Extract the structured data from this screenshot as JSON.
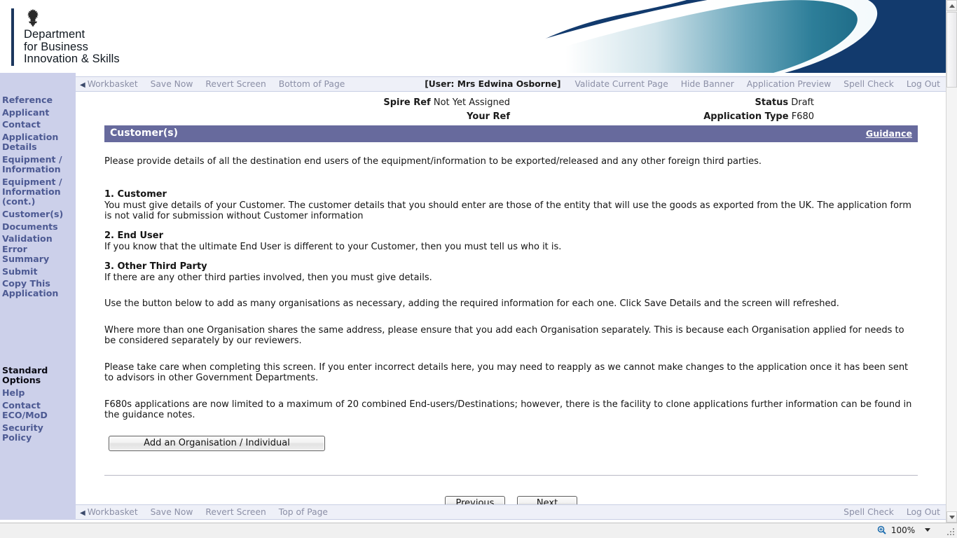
{
  "banner": {
    "crest_alt": "royal-crest",
    "department_line1": "Department",
    "department_line2": "for Business",
    "department_line3": "Innovation & Skills",
    "navy_color": "#123a6d",
    "swoosh_teal": "#2b7f99"
  },
  "topnav": {
    "workbasket": "Workbasket",
    "save_now": "Save Now",
    "revert_screen": "Revert Screen",
    "bottom_of_page": "Bottom of Page",
    "user": "[User: Mrs Edwina Osborne]",
    "validate_current_page": "Validate Current Page",
    "hide_banner": "Hide Banner",
    "application_preview": "Application Preview",
    "spell_check": "Spell Check",
    "log_out": "Log Out"
  },
  "sidebar": {
    "items": [
      {
        "label": "Reference"
      },
      {
        "label": "Applicant"
      },
      {
        "label": "Contact"
      },
      {
        "label": "Application\nDetails"
      },
      {
        "label": "Equipment /\nInformation"
      },
      {
        "label": "Equipment /\nInformation\n(cont.)"
      },
      {
        "label": "Customer(s)"
      },
      {
        "label": "Documents"
      },
      {
        "label": "Validation Error\nSummary"
      },
      {
        "label": "Submit"
      },
      {
        "label": "Copy This\nApplication"
      }
    ],
    "standard_options_heading": "Standard\nOptions",
    "standard_options": [
      {
        "label": "Help"
      },
      {
        "label": "Contact\nECO/MoD"
      },
      {
        "label": "Security Policy"
      }
    ],
    "bg_color": "#ccd0ea",
    "link_color": "#4d5a93"
  },
  "refbar": {
    "spire_ref_label": "Spire Ref",
    "spire_ref_value": "Not Yet Assigned",
    "your_ref_label": "Your Ref",
    "your_ref_value": "",
    "status_label": "Status",
    "status_value": "Draft",
    "application_type_label": "Application Type",
    "application_type_value": "F680"
  },
  "section": {
    "title": "Customer(s)",
    "guidance": "Guidance",
    "header_color": "#676a9d"
  },
  "body": {
    "intro": "Please provide details of all the destination end users of the equipment/information to be exported/released and any other foreign third parties.",
    "item1_heading": "1. Customer",
    "item1_text": "You must give details of your Customer. The customer details that you should enter are those of the entity that will use the goods as exported from the UK. The application form is not valid for submission without Customer information",
    "item2_heading": "2. End User",
    "item2_text": "If you know that the ultimate End User is different to your Customer, then you must tell us who it is.",
    "item3_heading": "3. Other Third Party",
    "item3_text": "If there are any other third parties involved, then you must give details.",
    "para_button": "Use the button below to add as many organisations as necessary, adding the required information for each one. Click Save Details and the screen will refreshed.",
    "para_address": "Where more than one Organisation shares the same address, please ensure that you add each Organisation separately. This is because each Organisation applied for needs to be considered separately by our reviewers.",
    "para_care": "Please take care when completing this screen. If you enter incorrect details here, you may need to reapply as we cannot make changes to the application once it has been sent to advisors in other Government Departments.",
    "para_limit": "F680s applications are now limited to a maximum of 20 combined End-users/Destinations; however, there is the facility to clone applications further information can be found in the guidance notes."
  },
  "buttons": {
    "add_organisation": "Add an Organisation / Individual",
    "previous": "Previous",
    "next": "Next"
  },
  "footnav": {
    "workbasket": "Workbasket",
    "save_now": "Save Now",
    "revert_screen": "Revert Screen",
    "top_of_page": "Top of Page",
    "spell_check": "Spell Check",
    "log_out": "Log Out"
  },
  "statusbar": {
    "zoom_level": "100%",
    "zoom_icon": "magnifier-plus-icon"
  }
}
